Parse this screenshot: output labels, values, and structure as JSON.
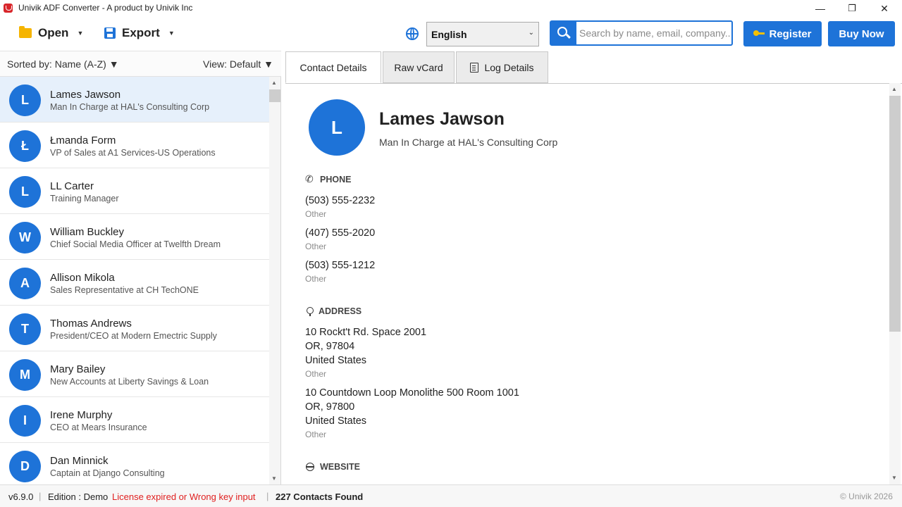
{
  "window": {
    "title": "Univik ADF Converter - A product by Univik Inc",
    "minimize": "—",
    "maximize": "❐",
    "close": "✕"
  },
  "toolbar": {
    "open_label": "Open",
    "export_label": "Export",
    "language": "English",
    "search_placeholder": "Search by name, email, company...",
    "register_label": "Register",
    "buy_label": "Buy Now"
  },
  "list": {
    "sort_label": "Sorted by: Name (A-Z) ▼",
    "view_label": "View: Default ▼",
    "contacts": [
      {
        "initial": "L",
        "name": "Lames Jawson",
        "subtitle": "Man In Charge at HAL's Consulting Corp"
      },
      {
        "initial": "Ł",
        "name": "Łmanda Form",
        "subtitle": "VP of Sales at A1 Services-US Operations"
      },
      {
        "initial": "L",
        "name": "LL Carter",
        "subtitle": "Training Manager"
      },
      {
        "initial": "W",
        "name": "William Buckley",
        "subtitle": "Chief Social Media Officer at Twelfth Dream"
      },
      {
        "initial": "A",
        "name": "Allison Mikola",
        "subtitle": "Sales Representative at CH TechONE"
      },
      {
        "initial": "T",
        "name": "Thomas Andrews",
        "subtitle": "President/CEO at Modern Emectric Supply"
      },
      {
        "initial": "M",
        "name": "Mary Bailey",
        "subtitle": "New Accounts at Liberty Savings & Loan"
      },
      {
        "initial": "I",
        "name": "Irene Murphy",
        "subtitle": "CEO at Mears Insurance"
      },
      {
        "initial": "D",
        "name": "Dan Minnick",
        "subtitle": "Captain at Django Consulting"
      }
    ]
  },
  "tabs": {
    "contact_details": "Contact Details",
    "raw_vcard": "Raw vCard",
    "log_details": "Log Details"
  },
  "detail": {
    "initial": "L",
    "name": "Lames Jawson",
    "subtitle": "Man In Charge at HAL's Consulting Corp",
    "phone_heading": "PHONE",
    "phones": [
      {
        "number": "(503) 555-2232",
        "type": "Other"
      },
      {
        "number": "(407) 555-2020",
        "type": "Other"
      },
      {
        "number": "(503) 555-1212",
        "type": "Other"
      }
    ],
    "address_heading": "ADDRESS",
    "addresses": [
      {
        "line1": "10 Rockt't Rd. Space 2001",
        "line2": "OR, 97804",
        "line3": "United States",
        "type": "Other"
      },
      {
        "line1": "10 Countdown Loop Monolithe 500 Room 1001",
        "line2": "OR, 97800",
        "line3": "United States",
        "type": "Other"
      }
    ],
    "website_heading": "WEBSITE"
  },
  "status": {
    "version": "v6.9.0",
    "edition": "Edition : Demo",
    "license_warning": "License expired or Wrong key input",
    "count": "227 Contacts Found",
    "copyright": "© Univik 2026"
  },
  "colors": {
    "accent": "#1e73d8",
    "warning": "#e02020",
    "selected_row": "#e6f0fb"
  }
}
